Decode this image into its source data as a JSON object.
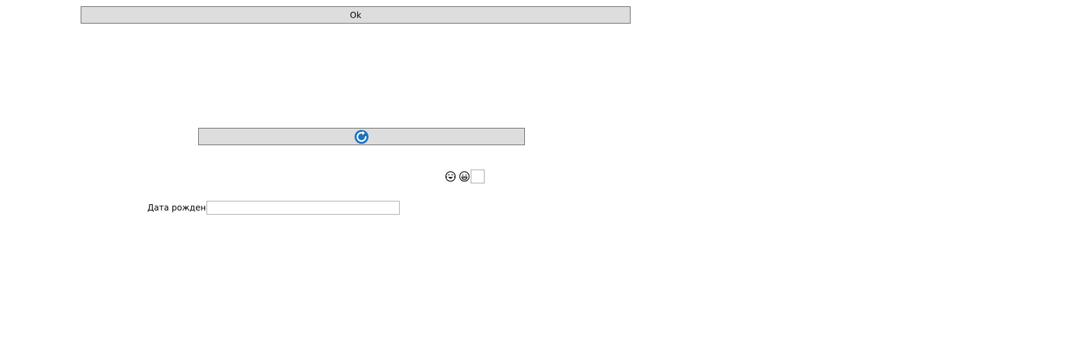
{
  "ok_button": {
    "label": "Ok"
  },
  "refresh_button": {
    "icon": "refresh-icon",
    "icon_color": "#1e73be"
  },
  "emoji_row": {
    "icons": [
      "crying-laughing-face-icon",
      "grinning-face-icon"
    ]
  },
  "birth_date": {
    "label": "Дата рождения",
    "value": ""
  },
  "colors": {
    "button_bg": "#dddddd",
    "button_border": "#707070",
    "accent": "#1e73be"
  }
}
